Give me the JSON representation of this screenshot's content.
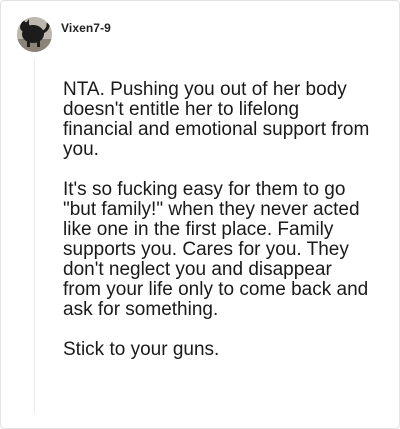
{
  "comment": {
    "author": "Vixen7-9",
    "avatar_icon": "user-avatar-photo",
    "paragraphs": [
      "NTA. Pushing you out of her body doesn't entitle her to lifelong financial and emotional support from you.",
      "It's so fucking easy for them to go \"but family!\" when they never acted like one in the first place. Family supports you. Cares for you. They don't neglect you and disappear from your life only to come back and ask for something.",
      "Stick to your guns."
    ]
  }
}
